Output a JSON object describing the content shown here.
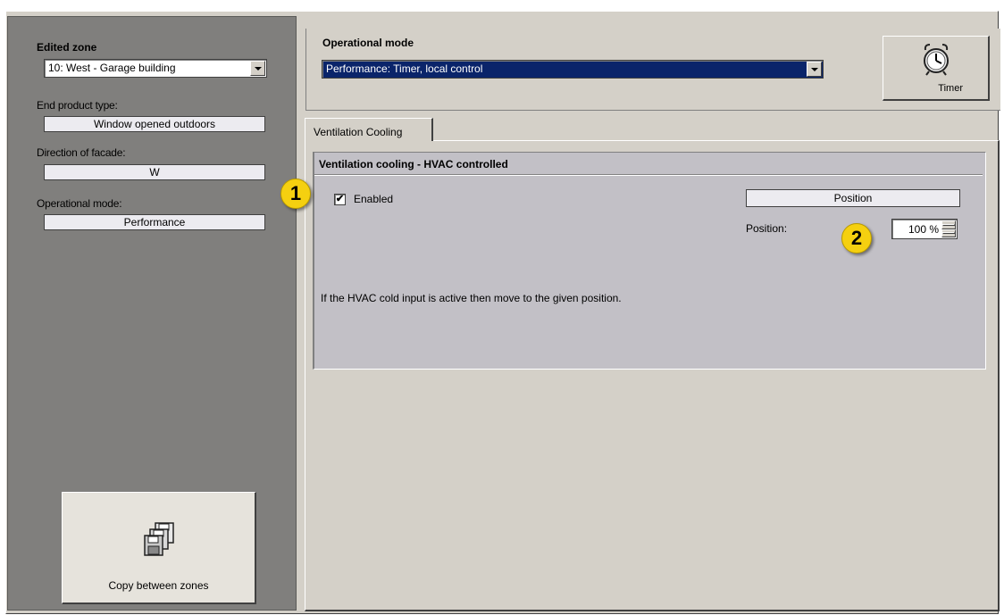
{
  "left_panel": {
    "edited_zone_heading": "Edited zone",
    "zone_select_value": "10: West - Garage building",
    "end_product_type_label": "End product type:",
    "end_product_type_value": "Window opened outdoors",
    "direction_label": "Direction of facade:",
    "direction_value": "W",
    "operational_mode_label": "Operational mode:",
    "operational_mode_value": "Performance",
    "copy_button_label": "Copy between zones",
    "copy_icon": "floppy-disks-icon"
  },
  "header": {
    "operational_mode_heading": "Operational mode",
    "operational_mode_select_value": "Performance: Timer, local control",
    "timer_button_label": "Timer",
    "timer_icon": "alarm-clock-icon"
  },
  "tabs": [
    {
      "label": "Ventilation Cooling",
      "active": true
    }
  ],
  "ventilation_group": {
    "title": "Ventilation cooling - HVAC controlled",
    "enabled_label": "Enabled",
    "enabled_checked": true,
    "position_header": "Position",
    "position_label": "Position:",
    "position_value": "100 %",
    "description": "If the HVAC cold input is active then move to the given position."
  },
  "callouts": [
    "1",
    "2"
  ],
  "colors": {
    "panel_gray": "#d4d0c8",
    "left_panel_dark": "#807f7d",
    "selection_blue": "#0a246a",
    "callout_yellow": "#f5d010"
  }
}
